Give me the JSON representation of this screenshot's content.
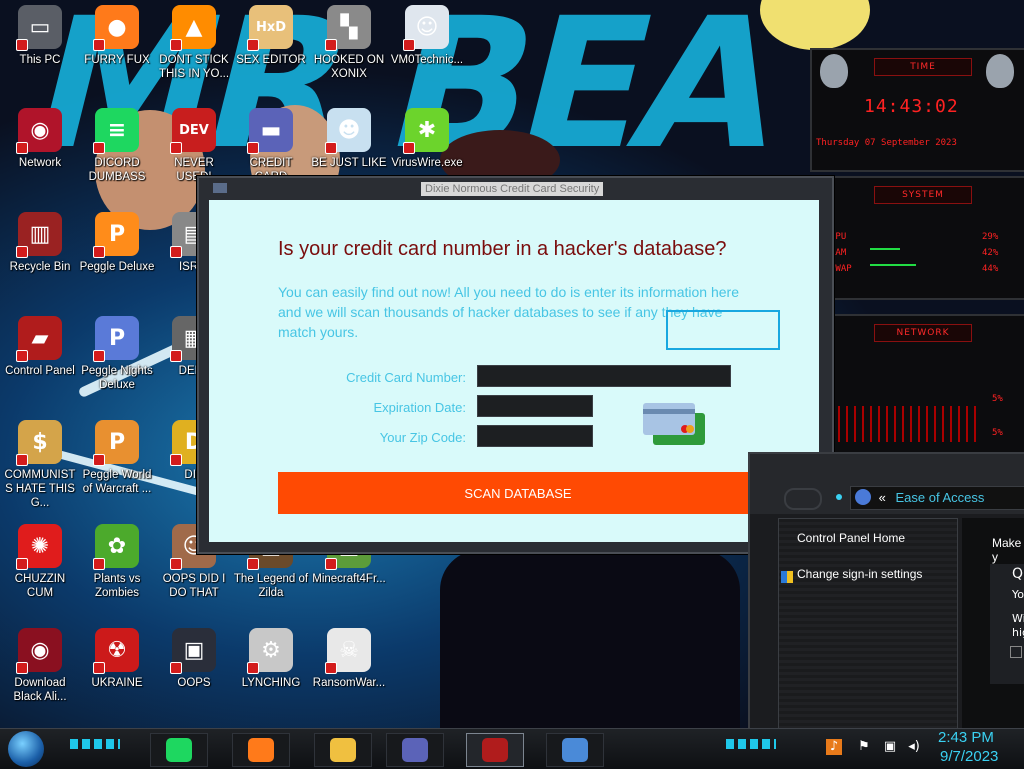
{
  "desktop": {
    "icons": [
      {
        "label": "This PC",
        "icon": "monitor-icon",
        "color": "#5a5e66",
        "glyph": "▭"
      },
      {
        "label": "FURRY FUX",
        "icon": "firefox-icon",
        "color": "#ff7a1a",
        "glyph": "●"
      },
      {
        "label": "DONT STICK THIS IN YO...",
        "icon": "vlc-cone-icon",
        "color": "#ff8c00",
        "glyph": "▲"
      },
      {
        "label": "SEX EDITOR",
        "icon": "hxd-editor-icon",
        "color": "#e8c07a",
        "glyph": "HxD"
      },
      {
        "label": "HOOKED ON XONIX",
        "icon": "xonix-game-icon",
        "color": "#8a8a8a",
        "glyph": "▚"
      },
      {
        "label": "VM0Technic...",
        "icon": "doctor-avatar-icon",
        "color": "#dfe6ee",
        "glyph": "☺"
      },
      {
        "label": "Network",
        "icon": "alienware-network-icon",
        "color": "#b0142a",
        "glyph": "◉"
      },
      {
        "label": "DICORD DUMBASS",
        "icon": "spotify-icon",
        "color": "#1ed760",
        "glyph": "≡"
      },
      {
        "label": "NEVER USED!",
        "icon": "dev-cpp-icon",
        "color": "#c81e1e",
        "glyph": "DEV"
      },
      {
        "label": "CREDIT CARD",
        "icon": "credit-card-icon",
        "color": "#5b63b8",
        "glyph": "▬"
      },
      {
        "label": "BE JUST LIKE",
        "icon": "santa-icon",
        "color": "#c8e0f0",
        "glyph": "☻"
      },
      {
        "label": "VirusWire.exe",
        "icon": "lime-wire-icon",
        "color": "#6cd42c",
        "glyph": "✱"
      },
      {
        "label": "Recycle Bin",
        "icon": "recycle-bin-icon",
        "color": "#9a2222",
        "glyph": "▥"
      },
      {
        "label": "Peggle Deluxe",
        "icon": "peggle-icon",
        "color": "#ff8c1a",
        "glyph": "P"
      },
      {
        "label": "ISRAI",
        "icon": "usb-drive-icon",
        "color": "#888",
        "glyph": "▤"
      },
      {
        "label": "Control Panel",
        "icon": "control-panel-icon",
        "color": "#b01c1c",
        "glyph": "▰"
      },
      {
        "label": "Peggle Nights Deluxe",
        "icon": "peggle-nights-icon",
        "color": "#5a7ad8",
        "glyph": "P"
      },
      {
        "label": "DEEZ",
        "icon": "printer-icon",
        "color": "#666",
        "glyph": "▦"
      },
      {
        "label": "COMMUNISTS HATE THIS G...",
        "icon": "money-bag-icon",
        "color": "#d4a44a",
        "glyph": "$"
      },
      {
        "label": "Peggle World of Warcraft ...",
        "icon": "peggle-wow-icon",
        "color": "#e89030",
        "glyph": "P"
      },
      {
        "label": "DIE",
        "icon": "dictionary-icon",
        "color": "#e0b020",
        "glyph": "D"
      },
      {
        "label": "CHUZZIN CUM",
        "icon": "chuzzle-icon",
        "color": "#e01c1c",
        "glyph": "✺"
      },
      {
        "label": "Plants vs Zombies",
        "icon": "plants-vs-zombies-icon",
        "color": "#4caa2c",
        "glyph": "✿"
      },
      {
        "label": "OOPS DID I DO THAT",
        "icon": "person-photo-icon",
        "color": "#a06a4a",
        "glyph": "☺"
      },
      {
        "label": "The Legend of Zilda",
        "icon": "zelda-icon",
        "color": "#6a4a2a",
        "glyph": "▲"
      },
      {
        "label": "Minecraft4Fr...",
        "icon": "minecraft-icon",
        "color": "#5c9c3a",
        "glyph": "■"
      },
      {
        "label": "Download Black Ali...",
        "icon": "alienware-download-icon",
        "color": "#8a1020",
        "glyph": "◉"
      },
      {
        "label": "UKRAINE",
        "icon": "radiation-icon",
        "color": "#cc1a1a",
        "glyph": "☢"
      },
      {
        "label": "OOPS",
        "icon": "terminal-icon",
        "color": "#2a2e3a",
        "glyph": "▣"
      },
      {
        "label": "LYNCHING",
        "icon": "network-tree-icon",
        "color": "#c8c8c8",
        "glyph": "⚙"
      },
      {
        "label": "RansomWar...",
        "icon": "skull-icon",
        "color": "#e8e8e8",
        "glyph": "☠"
      }
    ],
    "wallpaper_text": "MR BEA"
  },
  "dialog": {
    "title": "Dixie Normous Credit Card Security",
    "heading": "Is your credit card number in a hacker's database?",
    "description": "You can easily find out now! All you need to do is enter its information here and we will scan thousands of hacker databases to see if any they have match yours.",
    "fields": {
      "card_number_label": "Credit Card Number:",
      "expiration_label": "Expiration Date:",
      "zip_label": "Your Zip Code:",
      "card_number_value": "",
      "expiration_value": "",
      "zip_value": ""
    },
    "scan_button": "SCAN DATABASE",
    "colors": {
      "heading": "#7a0d0d",
      "text": "#47c5e4",
      "button": "#ff4a03",
      "background": "#d9fafa"
    }
  },
  "gadgets": {
    "time": {
      "header": "TIME",
      "clock": "14:43:02",
      "date": "Thursday 07 September 2023"
    },
    "system": {
      "header": "SYSTEM",
      "rows": [
        {
          "label": "CPU",
          "value": "29%"
        },
        {
          "label": "RAM",
          "value": "42%"
        },
        {
          "label": "SWAP",
          "value": "44%"
        }
      ]
    },
    "network": {
      "header": "NETWORK",
      "rows": [
        {
          "value": "5%"
        },
        {
          "value": "5%"
        }
      ]
    }
  },
  "control_panel": {
    "breadcrumb_chevron": "«",
    "address": "Ease of Access",
    "side_links": [
      "Control Panel Home",
      "Change sign-in settings"
    ],
    "main_fragments": [
      "Make y",
      "Q",
      "Yo",
      "Wi",
      "hig"
    ]
  },
  "taskbar": {
    "apps": [
      {
        "icon": "spotify-icon",
        "color": "#1ed760"
      },
      {
        "icon": "firefox-icon",
        "color": "#ff7a1a"
      },
      {
        "icon": "file-explorer-icon",
        "color": "#f0c040"
      },
      {
        "icon": "credit-card-icon",
        "color": "#5b63b8"
      },
      {
        "icon": "control-panel-icon",
        "color": "#b01c1c"
      },
      {
        "icon": "network-monitor-icon",
        "color": "#4a8ad8"
      }
    ],
    "clock_time": "2:43 PM",
    "clock_date": "9/7/2023"
  }
}
